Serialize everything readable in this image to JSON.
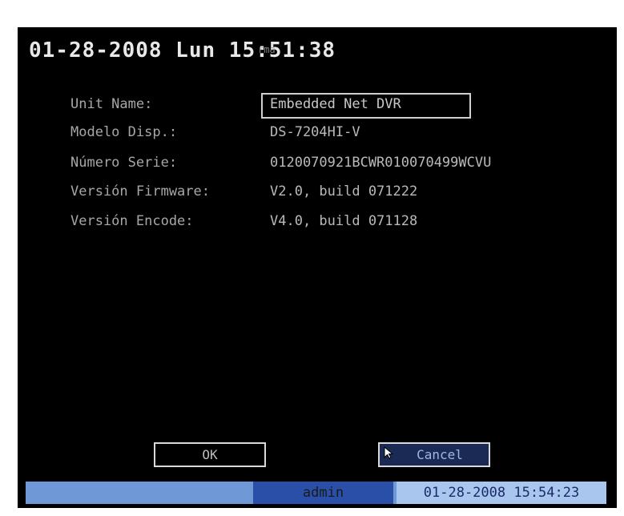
{
  "header": {
    "clock": "01-28-2008 Lun 15:51:38",
    "ghost_title": "rma"
  },
  "info": {
    "unit_name_label": "Unit Name:",
    "unit_name_value": "Embedded Net DVR",
    "model_label": "Modelo Disp.:",
    "model_value": "DS-7204HI-V",
    "serial_label": "Número Serie:",
    "serial_value": "0120070921BCWR010070499WCVU",
    "firmware_label": "Versión Firmware:",
    "firmware_value": "V2.0, build 071222",
    "encode_label": "Versión Encode:",
    "encode_value": "V4.0, build 071128"
  },
  "buttons": {
    "ok_label": "OK",
    "cancel_label": "Cancel"
  },
  "statusbar": {
    "user": "admin",
    "datetime": "01-28-2008 15:54:23"
  },
  "colors": {
    "screen_bg": "#000000",
    "status_bar": "#6f99d6",
    "status_user": "#2a4fa8",
    "status_time": "#a9c6ef",
    "cancel_bg": "#1b2a55"
  }
}
